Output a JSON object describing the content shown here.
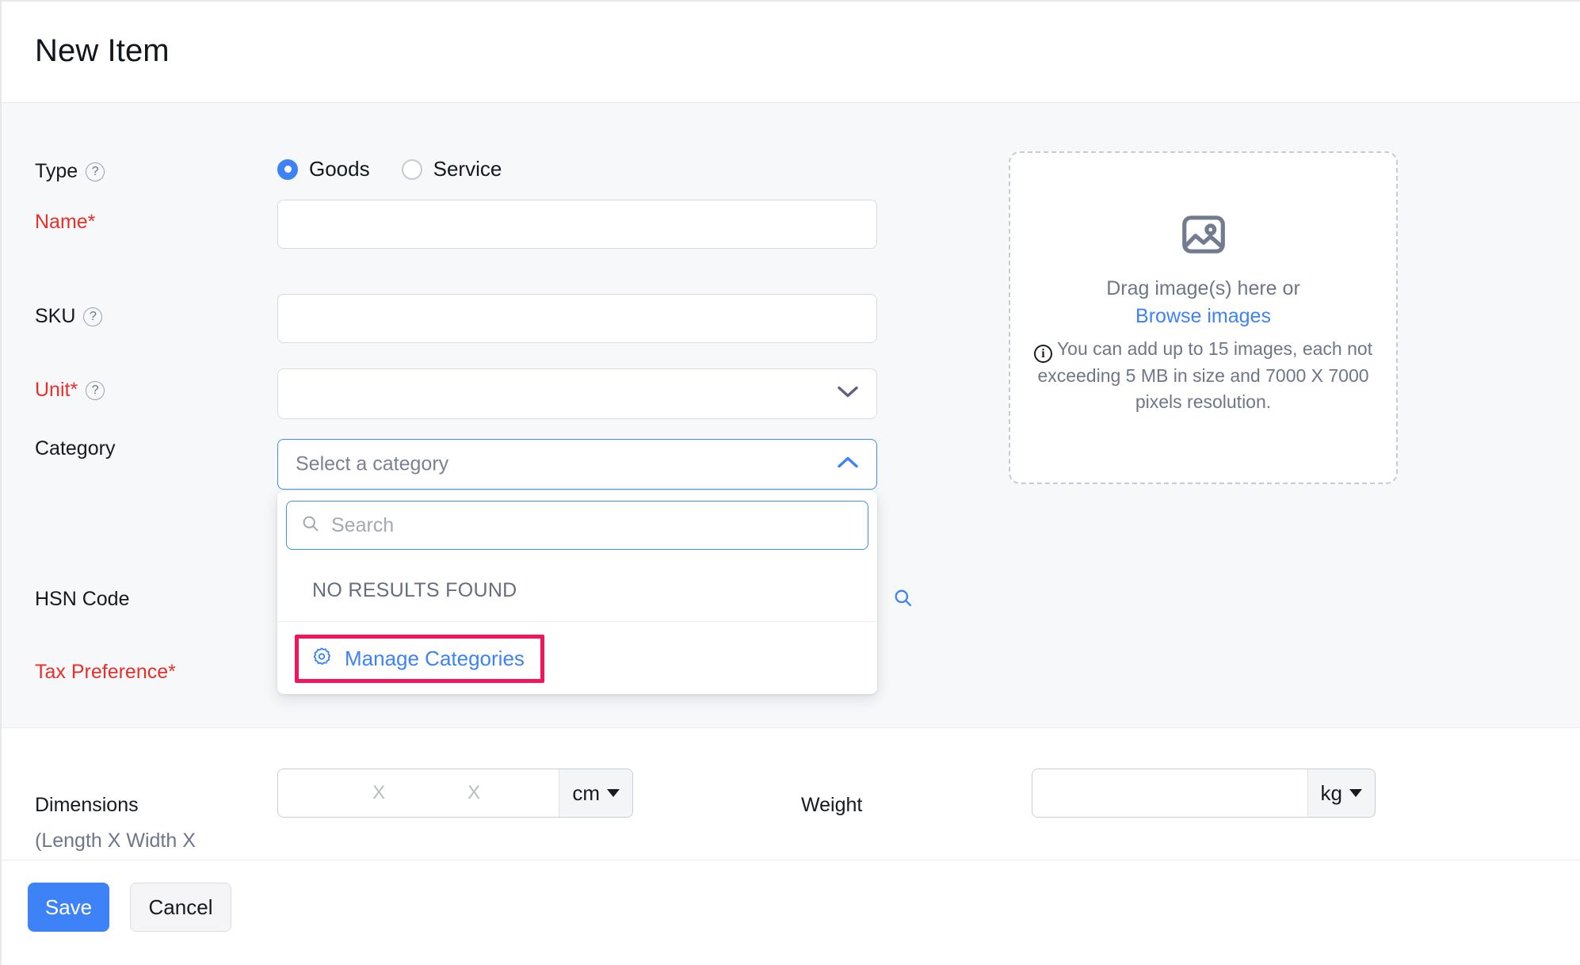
{
  "header": {
    "title": "New Item"
  },
  "form": {
    "type": {
      "label": "Type",
      "help_icon": "question-mark-icon",
      "options": [
        {
          "label": "Goods",
          "selected": true
        },
        {
          "label": "Service",
          "selected": false
        }
      ]
    },
    "name": {
      "label": "Name*",
      "value": "",
      "required": true
    },
    "sku": {
      "label": "SKU",
      "value": "",
      "help_icon": "question-mark-icon"
    },
    "unit": {
      "label": "Unit*",
      "value": "",
      "required": true,
      "help_icon": "question-mark-icon",
      "chevron": "chevron-down-icon"
    },
    "category": {
      "label": "Category",
      "placeholder": "Select a category",
      "value": "",
      "expanded": true,
      "chevron": "chevron-up-icon"
    },
    "hsn_code": {
      "label": "HSN Code",
      "search_icon": "search-icon"
    },
    "tax_preference": {
      "label": "Tax Preference*",
      "required": true
    },
    "dimensions": {
      "label": "Dimensions",
      "sublabel": "(Length X Width X",
      "separator": "X",
      "unit": "cm",
      "length": "",
      "width": "",
      "height": ""
    },
    "weight": {
      "label": "Weight",
      "value": "",
      "unit": "kg"
    }
  },
  "category_dropdown": {
    "search_placeholder": "Search",
    "search_icon": "search-icon",
    "no_results_text": "NO RESULTS FOUND",
    "manage_label": "Manage Categories",
    "manage_icon": "gear-icon",
    "highlight_color": "#f4145b"
  },
  "image_upload": {
    "icon": "image-placeholder-icon",
    "drag_text": "Drag image(s) here or",
    "browse_label": "Browse images",
    "info_icon": "info-icon",
    "note": "You can add up to 15 images, each not exceeding 5 MB in size and 7000 X 7000 pixels resolution."
  },
  "footer": {
    "save_label": "Save",
    "cancel_label": "Cancel"
  },
  "colors": {
    "accent": "#3e82f7",
    "required": "#e8302b",
    "highlight": "#f4145b",
    "page_bg": "#f7f8fa"
  }
}
